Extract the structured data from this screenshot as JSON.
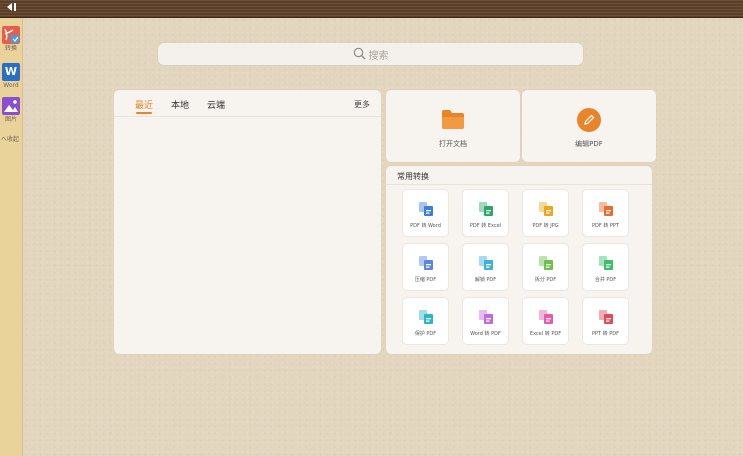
{
  "topbar": {
    "back_icon": "exit-icon"
  },
  "sidebar": {
    "items": [
      {
        "label": "转换",
        "icon": "pdf-convert-icon"
      },
      {
        "label": "Word",
        "icon": "word-icon",
        "glyph": "W"
      },
      {
        "label": "图片",
        "icon": "image-icon"
      }
    ],
    "collapse_label": "へ收起"
  },
  "search": {
    "placeholder": "搜索",
    "icon": "search-icon"
  },
  "recent": {
    "tabs": [
      {
        "label": "最近",
        "active": true
      },
      {
        "label": "本地",
        "active": false
      },
      {
        "label": "云端",
        "active": false
      }
    ],
    "more_label": "更多"
  },
  "quick_actions": [
    {
      "label": "打开文档",
      "icon": "folder-icon",
      "color": "#e8842a"
    },
    {
      "label": "编辑PDF",
      "icon": "pencil-icon",
      "color": "#e8842a"
    }
  ],
  "common": {
    "title": "常用转换",
    "tools": [
      {
        "label": "PDF 转 Word",
        "icon": "pdf-to-word-icon",
        "color": "#3a7fdc"
      },
      {
        "label": "PDF 转 Excel",
        "icon": "pdf-to-excel-icon",
        "color": "#2aa86a"
      },
      {
        "label": "PDF 转 JPG",
        "icon": "pdf-to-jpg-icon",
        "color": "#f0a418"
      },
      {
        "label": "PDF 转 PPT",
        "icon": "pdf-to-ppt-icon",
        "color": "#ec6a2c"
      },
      {
        "label": "压缩 PDF",
        "icon": "compress-pdf-icon",
        "color": "#5b86e0"
      },
      {
        "label": "解锁 PDF",
        "icon": "unlock-pdf-icon",
        "color": "#3ab3d6"
      },
      {
        "label": "拆分 PDF",
        "icon": "split-pdf-icon",
        "color": "#6cc24a"
      },
      {
        "label": "合并 PDF",
        "icon": "merge-pdf-icon",
        "color": "#38c06a"
      },
      {
        "label": "保护 PDF",
        "icon": "protect-pdf-icon",
        "color": "#2bb5c8"
      },
      {
        "label": "Word 转 PDF",
        "icon": "word-to-pdf-icon",
        "color": "#c46ad8"
      },
      {
        "label": "Excel 转 PDF",
        "icon": "excel-to-pdf-icon",
        "color": "#e85aa8"
      },
      {
        "label": "PPT 转 PDF",
        "icon": "ppt-to-pdf-icon",
        "color": "#e24a5a"
      }
    ]
  }
}
